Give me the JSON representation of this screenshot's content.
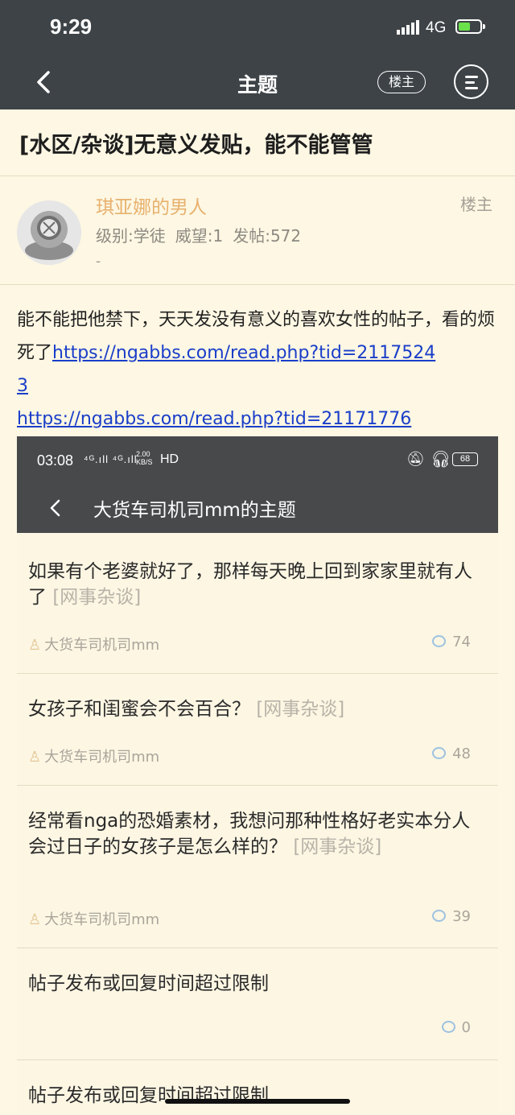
{
  "status_bar": {
    "time": "9:29",
    "network": "4G"
  },
  "navbar": {
    "title": "主题",
    "owner_button": "楼主"
  },
  "topic": {
    "title": "[水区/杂谈]无意义发贴，能不能管管"
  },
  "post": {
    "username": "琪亚娜的男人",
    "owner_tag": "楼主",
    "level": "级别:学徒",
    "prestige": "威望:1",
    "post_count": "发帖:572",
    "signature": "-",
    "body_text": "能不能把他禁下，天天发没有意义的喜欢女性的帖子，看的烦死了",
    "link1_a": "https://ngabbs.com/read.php?tid=2117524",
    "link1_b": "3",
    "link2": "https://ngabbs.com/read.php?tid=21171776"
  },
  "embedded_screenshot": {
    "status": {
      "time": "03:08",
      "signal": "⁴ᴳ.ıll ⁴ᴳ.ıll",
      "speed": "2.00 KB/S",
      "hd": "HD",
      "battery": "68"
    },
    "title": "大货车司机司mm的主题",
    "items": [
      {
        "title": "如果有个老婆就好了，那样每天晚上回到家家里就有人了",
        "category": "[网事杂谈]",
        "author": "大货车司机司mm",
        "replies": "74"
      },
      {
        "title": "女孩子和闺蜜会不会百合？",
        "category": "[网事杂谈]",
        "author": "大货车司机司mm",
        "replies": "48"
      },
      {
        "title": "经常看nga的恐婚素材，我想问那种性格好老实本分人会过日子的女孩子是怎么样的？",
        "category": "[网事杂谈]",
        "author": "大货车司机司mm",
        "replies": "39"
      },
      {
        "title": "帖子发布或回复时间超过限制",
        "category": "",
        "author": "",
        "replies": "0"
      },
      {
        "title": "帖子发布或回复时间超过限制",
        "category": "",
        "author": "",
        "replies": ""
      }
    ]
  },
  "colors": {
    "bar": "#3d4347",
    "background": "#fdf7e3",
    "username": "#e8b16e",
    "link": "#1a3ec9"
  }
}
